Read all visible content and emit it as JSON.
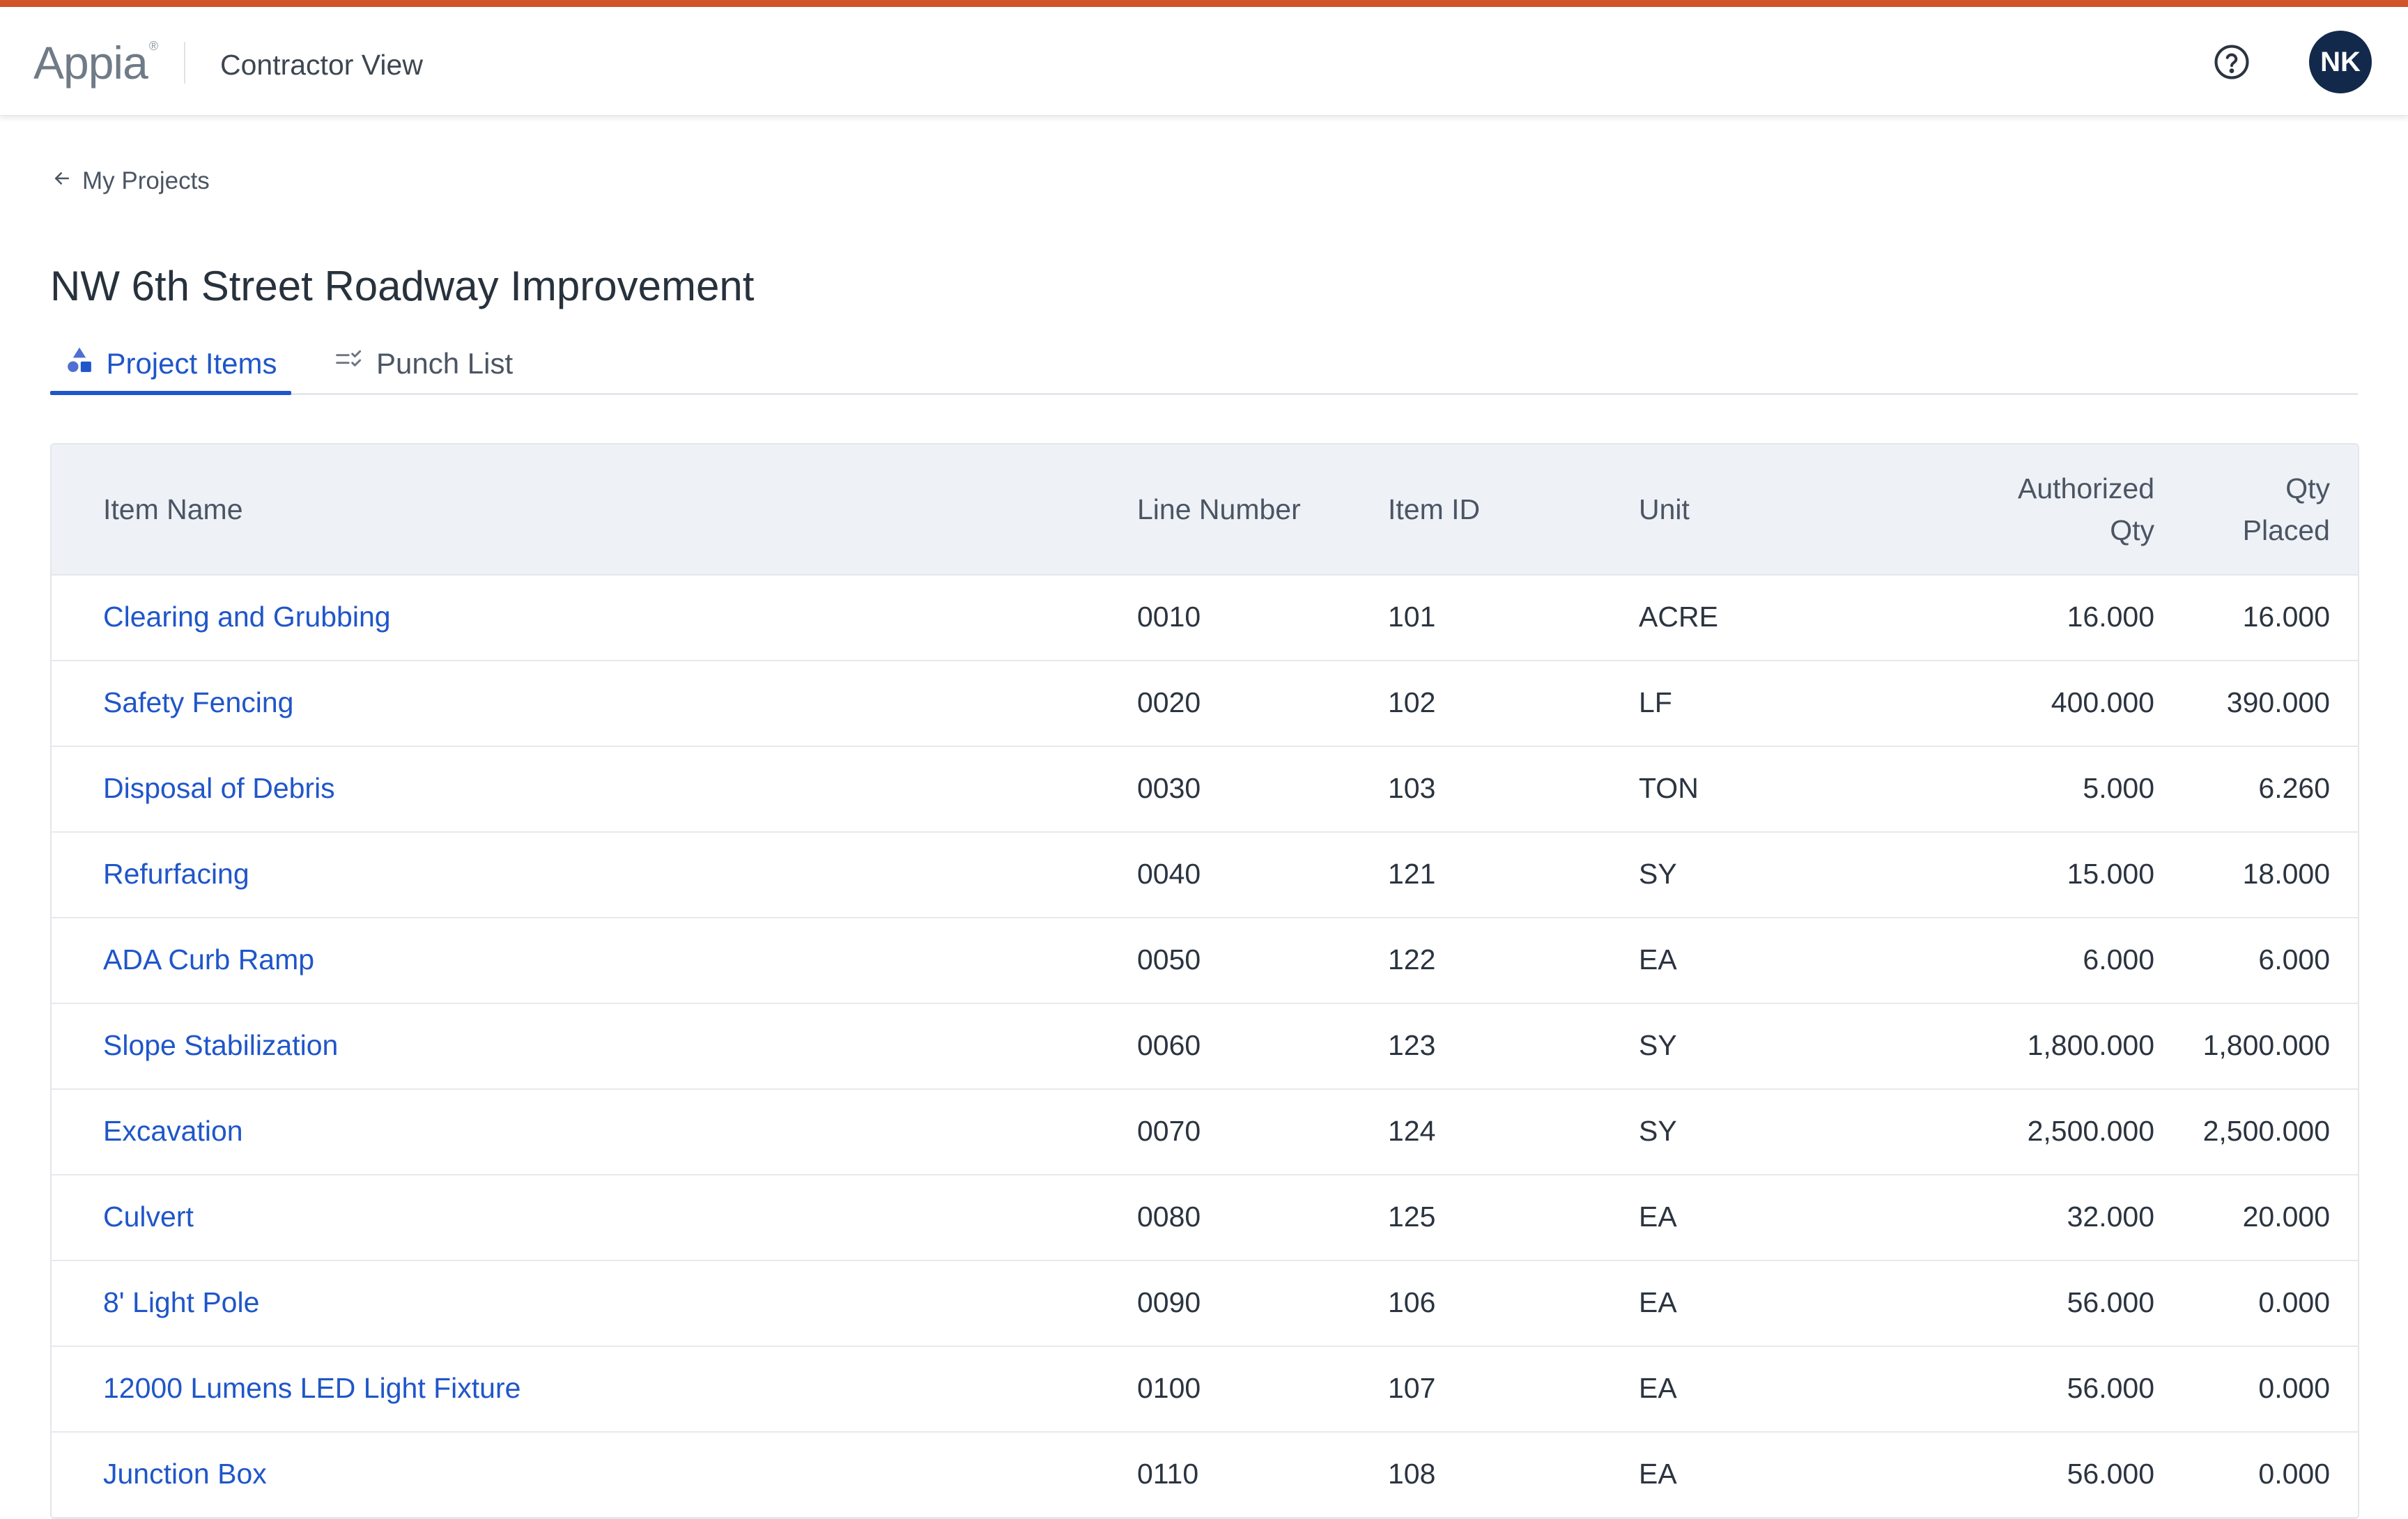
{
  "colors": {
    "accent": "#d2542a",
    "link": "#1f56c9",
    "avatar_bg": "#13294b",
    "header_bg": "#eef1f6"
  },
  "header": {
    "logo": "Appia",
    "logo_mark": "®",
    "view_title": "Contractor View",
    "help_icon": "help-circle-icon",
    "avatar_initials": "NK"
  },
  "breadcrumb": {
    "back_icon": "arrow-left-icon",
    "label": "My Projects"
  },
  "page": {
    "title": "NW 6th Street Roadway Improvement"
  },
  "tabs": [
    {
      "label": "Project Items",
      "icon": "shapes-icon",
      "active": true
    },
    {
      "label": "Punch List",
      "icon": "checklist-icon",
      "active": false
    }
  ],
  "table": {
    "columns": {
      "item_name": "Item Name",
      "line_number": "Line Number",
      "item_id": "Item ID",
      "unit": "Unit",
      "authorized_qty_1": "Authorized",
      "authorized_qty_2": "Qty",
      "qty_placed_1": "Qty",
      "qty_placed_2": "Placed"
    },
    "rows": [
      {
        "name": "Clearing and Grubbing",
        "line": "0010",
        "id": "101",
        "unit": "ACRE",
        "auth": "16.000",
        "placed": "16.000"
      },
      {
        "name": "Safety Fencing",
        "line": "0020",
        "id": "102",
        "unit": "LF",
        "auth": "400.000",
        "placed": "390.000"
      },
      {
        "name": "Disposal of Debris",
        "line": "0030",
        "id": "103",
        "unit": "TON",
        "auth": "5.000",
        "placed": "6.260"
      },
      {
        "name": "Refurfacing",
        "line": "0040",
        "id": "121",
        "unit": "SY",
        "auth": "15.000",
        "placed": "18.000"
      },
      {
        "name": "ADA Curb Ramp",
        "line": "0050",
        "id": "122",
        "unit": "EA",
        "auth": "6.000",
        "placed": "6.000"
      },
      {
        "name": "Slope Stabilization",
        "line": "0060",
        "id": "123",
        "unit": "SY",
        "auth": "1,800.000",
        "placed": "1,800.000"
      },
      {
        "name": "Excavation",
        "line": "0070",
        "id": "124",
        "unit": "SY",
        "auth": "2,500.000",
        "placed": "2,500.000"
      },
      {
        "name": "Culvert",
        "line": "0080",
        "id": "125",
        "unit": "EA",
        "auth": "32.000",
        "placed": "20.000"
      },
      {
        "name": "8' Light Pole",
        "line": "0090",
        "id": "106",
        "unit": "EA",
        "auth": "56.000",
        "placed": "0.000"
      },
      {
        "name": "12000 Lumens LED Light Fixture",
        "line": "0100",
        "id": "107",
        "unit": "EA",
        "auth": "56.000",
        "placed": "0.000"
      },
      {
        "name": "Junction Box",
        "line": "0110",
        "id": "108",
        "unit": "EA",
        "auth": "56.000",
        "placed": "0.000"
      }
    ]
  }
}
